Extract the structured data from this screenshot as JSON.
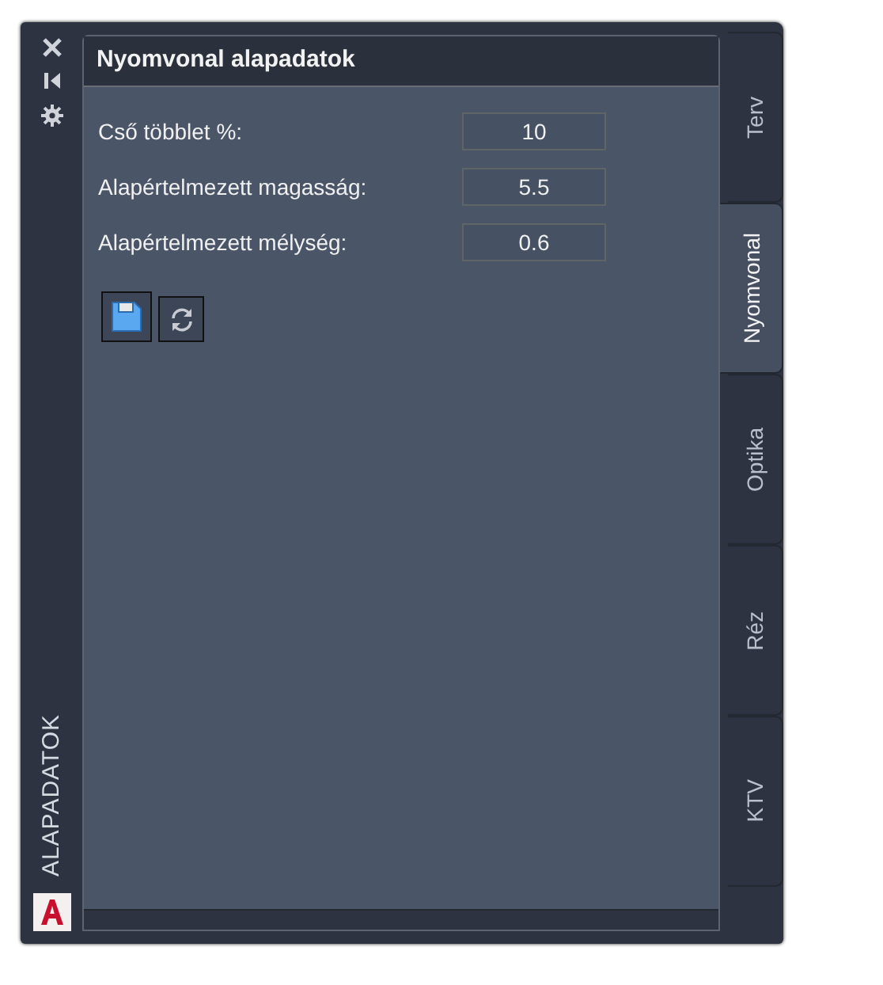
{
  "side_strip": {
    "title": "ALAPADATOK"
  },
  "panel": {
    "title": "Nyomvonal alapadatok"
  },
  "fields": [
    {
      "label": "Cső többlet %:",
      "value": "10"
    },
    {
      "label": "Alapértelmezett magasság:",
      "value": "5.5"
    },
    {
      "label": "Alapértelmezett mélység:",
      "value": "0.6"
    }
  ],
  "tabs": [
    {
      "label": "Terv",
      "selected": false
    },
    {
      "label": "Nyomvonal",
      "selected": true
    },
    {
      "label": "Optika",
      "selected": false
    },
    {
      "label": "Réz",
      "selected": false
    },
    {
      "label": "KTV",
      "selected": false
    }
  ]
}
